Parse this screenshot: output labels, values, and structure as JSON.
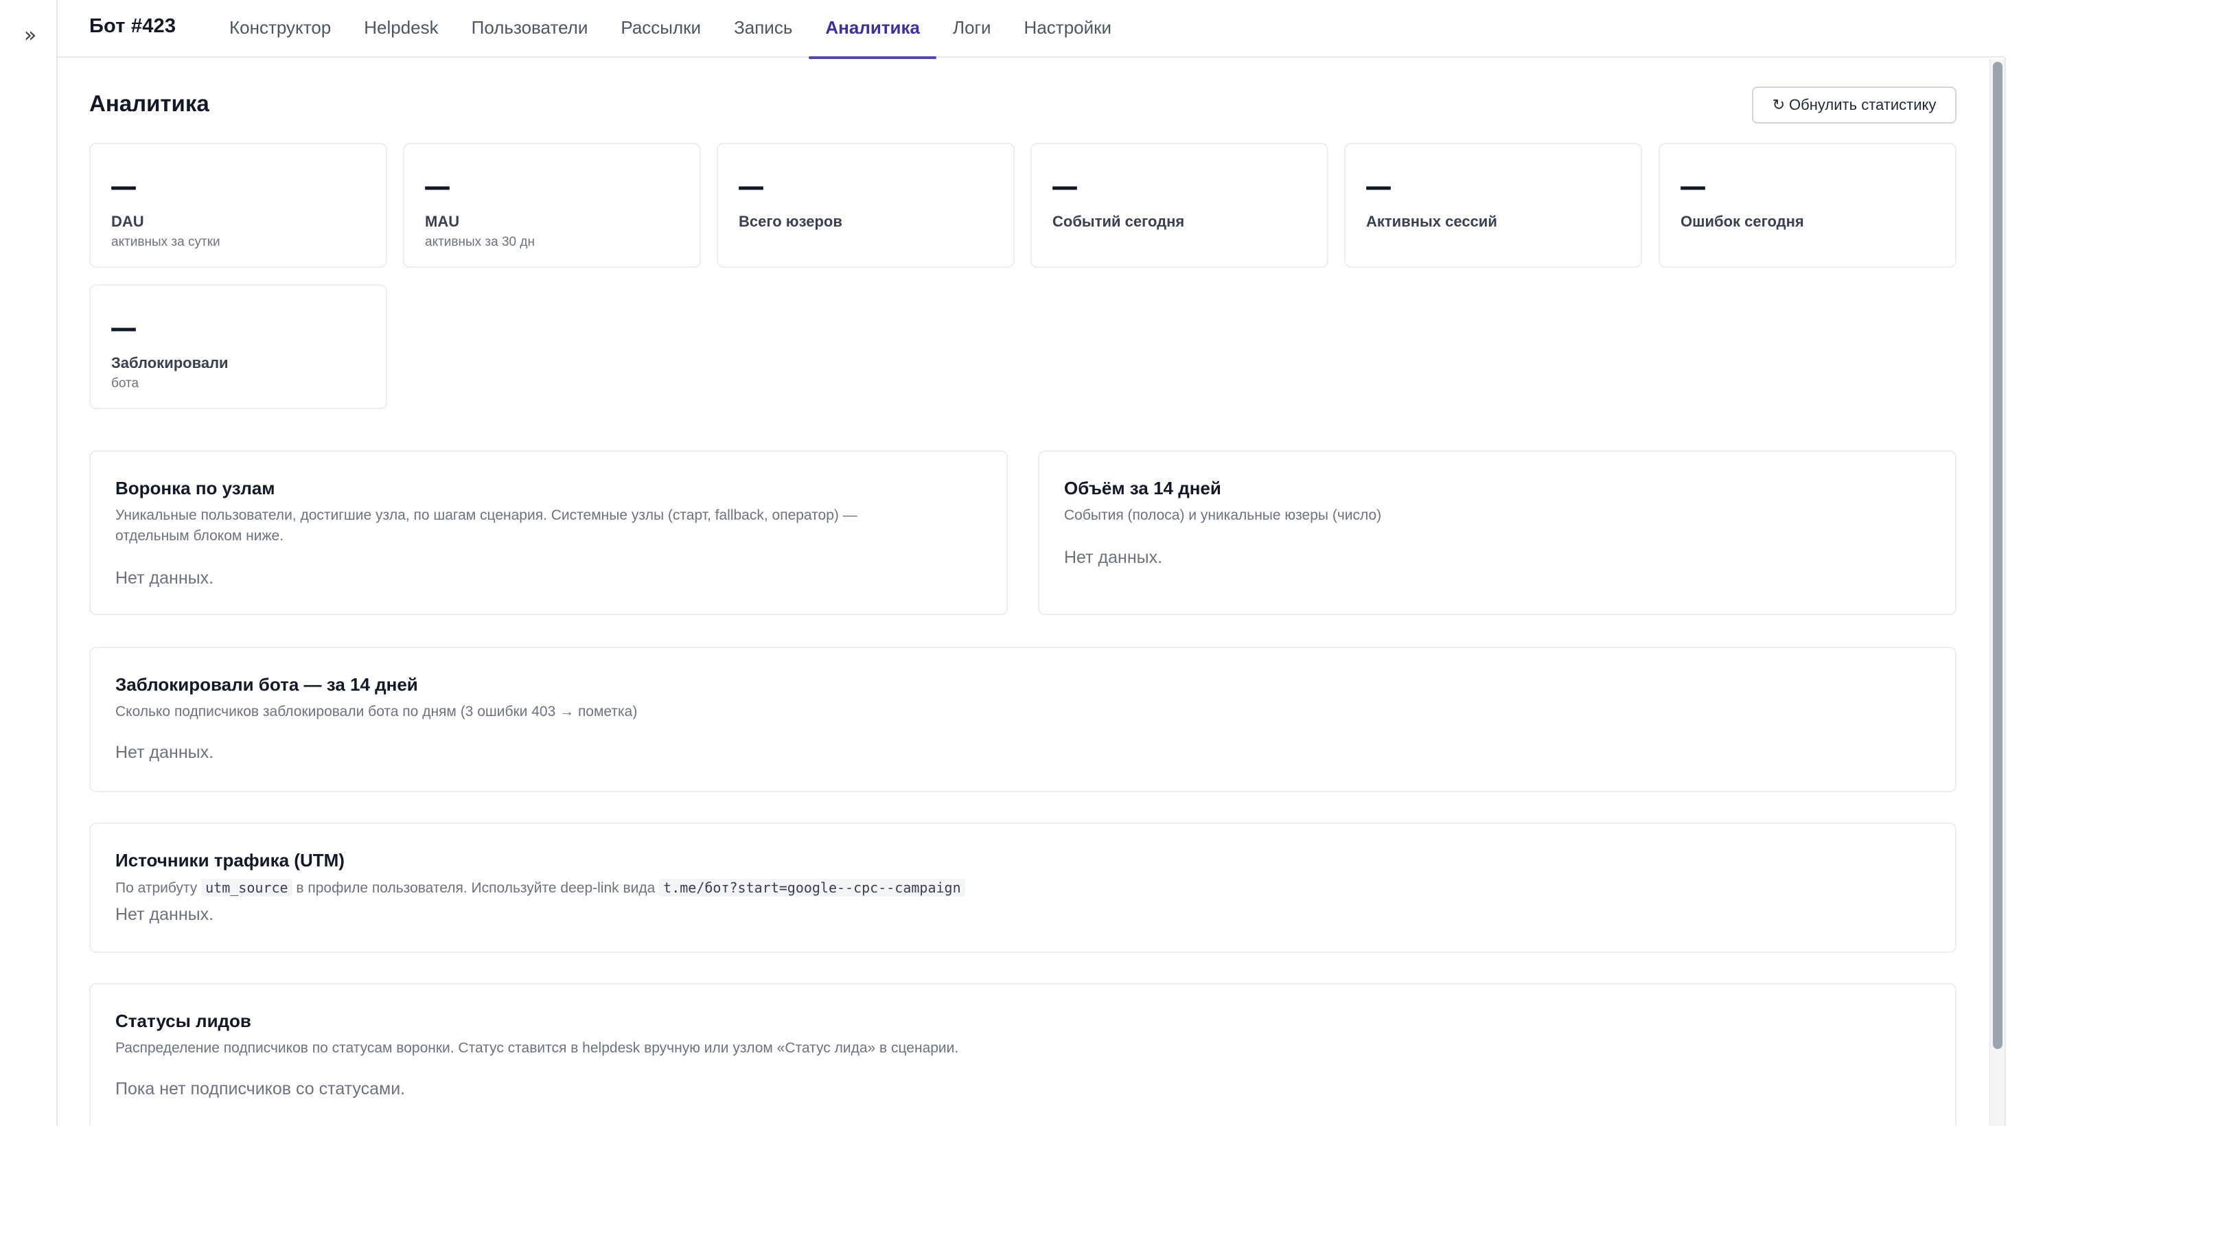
{
  "nav": {
    "toggle_icon": "»",
    "brand": "Бот #423",
    "tabs": [
      {
        "label": "Конструктор"
      },
      {
        "label": "Helpdesk"
      },
      {
        "label": "Пользователи"
      },
      {
        "label": "Рассылки"
      },
      {
        "label": "Запись"
      },
      {
        "label": "Аналитика",
        "active": true
      },
      {
        "label": "Логи"
      },
      {
        "label": "Настройки"
      }
    ],
    "accent_color": "#4f46b8"
  },
  "page": {
    "title": "Аналитика",
    "reset_icon": "↻",
    "reset_label": "Обнулить статистику"
  },
  "stats": [
    {
      "value": "—",
      "label": "DAU",
      "hint": "активных за сутки"
    },
    {
      "value": "—",
      "label": "MAU",
      "hint": "активных за 30 дн"
    },
    {
      "value": "—",
      "label": "Всего юзеров",
      "hint": ""
    },
    {
      "value": "—",
      "label": "Событий сегодня",
      "hint": ""
    },
    {
      "value": "—",
      "label": "Активных сессий",
      "hint": ""
    },
    {
      "value": "—",
      "label": "Ошибок сегодня",
      "hint": ""
    },
    {
      "value": "—",
      "label": "Заблокировали",
      "hint": "бота"
    }
  ],
  "funnel": {
    "title": "Воронка по узлам",
    "desc_line1": "Уникальные пользователи, достигшие узла, по шагам сценария. Системные узлы (старт, fallback, оператор) —",
    "desc_line2": "отдельным блоком ниже.",
    "empty": "Нет данных."
  },
  "volume": {
    "title": "Объём за 14 дней",
    "desc": "События (полоса) и уникальные юзеры (число)",
    "empty": "Нет данных."
  },
  "blocked": {
    "title": "Заблокировали бота — за 14 дней",
    "desc": "Сколько подписчиков заблокировали бота по дням (3 ошибки 403 → пометка)",
    "empty": "Нет данных."
  },
  "utm": {
    "title": "Источники трафика (UTM)",
    "desc_prefix": "По атрибуту",
    "desc_code1": "utm_source",
    "desc_middle": "в профиле пользователя. Используйте deep-link вида",
    "desc_code2": "t.me/бот?start=google--cpc--campaign",
    "empty": "Нет данных."
  },
  "leads": {
    "title": "Статусы лидов",
    "desc": "Распределение подписчиков по статусам воронки. Статус ставится в helpdesk вручную или узлом «Статус лида» в сценарии.",
    "empty": "Пока нет подписчиков со статусами."
  }
}
